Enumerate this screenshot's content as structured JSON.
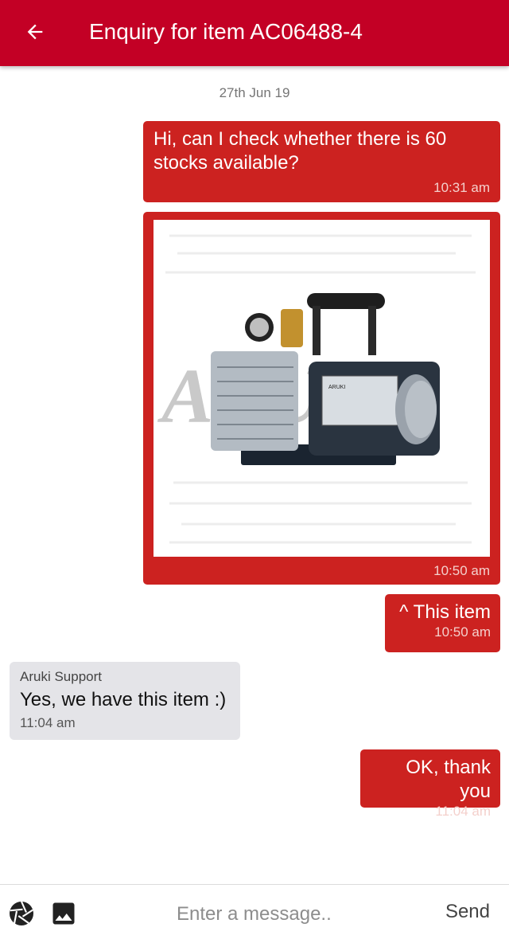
{
  "header": {
    "title": "Enquiry for item AC06488-4",
    "back_icon": "arrow-left-icon"
  },
  "conversation": {
    "date_separator": "27th Jun 19",
    "messages": [
      {
        "direction": "outgoing",
        "text": "Hi, can I check whether there is 60 stocks available?",
        "time": "10:31 am"
      },
      {
        "direction": "outgoing",
        "type": "image",
        "image_alt": "vacuum pump product photo",
        "watermark": "ARUKI",
        "time": "10:50 am"
      },
      {
        "direction": "outgoing",
        "text": "^ This item",
        "time": "10:50 am"
      },
      {
        "direction": "incoming",
        "sender": "Aruki Support",
        "text": "Yes, we have this item :)",
        "time": "11:04 am"
      },
      {
        "direction": "outgoing",
        "text": "OK, thank you",
        "time": "11:04 am"
      }
    ]
  },
  "composer": {
    "camera_icon": "camera-aperture-icon",
    "gallery_icon": "image-icon",
    "placeholder": "Enter a message..",
    "value": "",
    "send_label": "Send"
  },
  "colors": {
    "brand": "#c30025",
    "bubble_out": "#cc2220",
    "bubble_in": "#e4e4e8"
  }
}
